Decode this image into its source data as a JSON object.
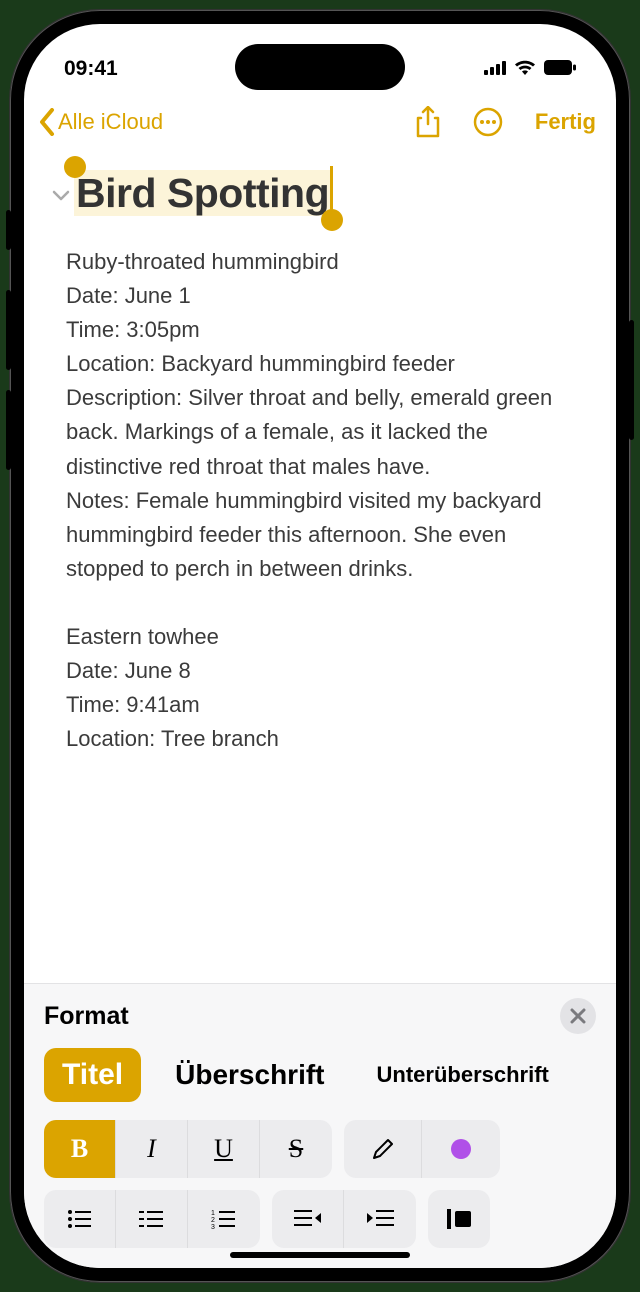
{
  "status": {
    "time": "09:41"
  },
  "nav": {
    "back": "Alle iCloud",
    "done": "Fertig"
  },
  "note": {
    "title": "Bird Spotting",
    "body1": [
      "Ruby-throated hummingbird",
      "Date: June 1",
      "Time: 3:05pm",
      "Location: Backyard hummingbird feeder",
      "Description: Silver throat and belly, emerald green back. Markings of a female, as it lacked the distinctive red throat that males have.",
      "Notes: Female hummingbird visited my backyard hummingbird feeder this afternoon. She even stopped to perch in between drinks."
    ],
    "body2": [
      "Eastern towhee",
      "Date: June 8",
      "Time: 9:41am",
      "Location: Tree branch"
    ]
  },
  "format": {
    "heading": "Format",
    "styles": {
      "title": "Titel",
      "heading": "Überschrift",
      "subheading": "Unterüberschrift"
    },
    "inline": {
      "bold": "B",
      "italic": "I",
      "underline": "U",
      "strike": "S"
    }
  }
}
